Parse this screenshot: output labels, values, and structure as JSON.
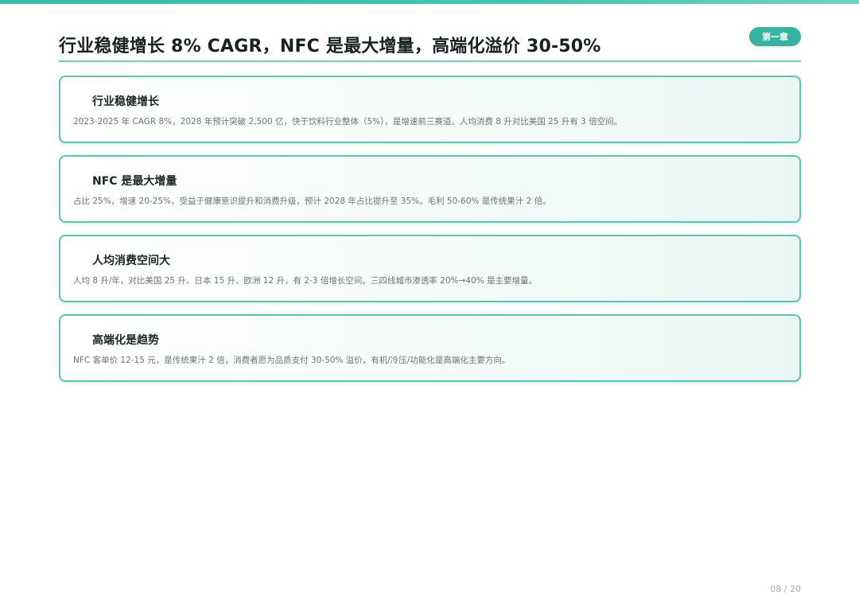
{
  "header": {
    "title": "行业稳健增长 8% CAGR，NFC 是最大增量，高端化溢价 30-50%",
    "chapter_badge": "第一章"
  },
  "cards": [
    {
      "title": "行业稳健增长",
      "text": "2023-2025 年 CAGR 8%，2028 年预计突破 2,500 亿，快于饮料行业整体（5%），是增速前三赛道。人均消费 8 升对比美国 25 升有 3 倍空间。"
    },
    {
      "title": "NFC 是最大增量",
      "text": "占比 25%，增速 20-25%，受益于健康意识提升和消费升级，预计 2028 年占比提升至 35%。毛利 50-60% 是传统果汁 2 倍。"
    },
    {
      "title": "人均消费空间大",
      "text": "人均 8 升/年，对比美国 25 升、日本 15 升、欧洲 12 升，有 2-3 倍增长空间。三四线城市渗透率 20%→40% 是主要增量。"
    },
    {
      "title": "高端化是趋势",
      "text": "NFC 客单价 12-15 元，是传统果汁 2 倍，消费者愿为品质支付 30-50% 溢价，有机/冷压/功能化是高端化主要方向。"
    }
  ],
  "footer": {
    "page_number": "08 / 20"
  },
  "colors": {
    "accent": "#39b3a1",
    "card_border": "#5cc3b2",
    "rule": "#72cbbd"
  }
}
